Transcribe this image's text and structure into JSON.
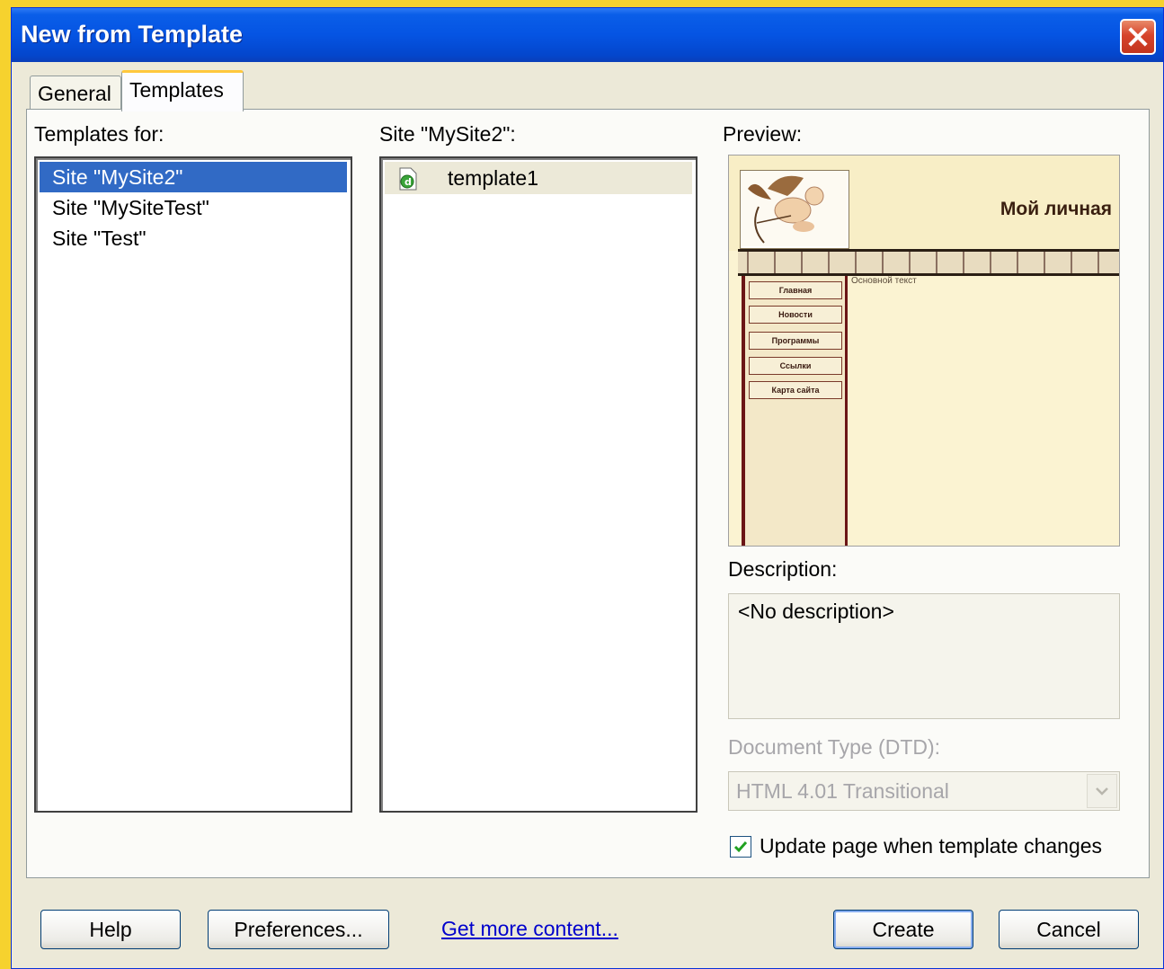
{
  "window": {
    "title": "New from Template"
  },
  "tabs": [
    {
      "label": "General"
    },
    {
      "label": "Templates"
    }
  ],
  "templates_for": {
    "label": "Templates for:",
    "items": [
      {
        "label": "Site \"MySite2\"",
        "selected": true
      },
      {
        "label": "Site \"MySiteTest\"",
        "selected": false
      },
      {
        "label": "Site \"Test\"",
        "selected": false
      }
    ]
  },
  "site_list": {
    "label": "Site \"MySite2\":",
    "items": [
      {
        "label": "template1",
        "icon": "dreamweaver-template-icon"
      }
    ]
  },
  "preview": {
    "label": "Preview:",
    "page_title": "Мой личная",
    "nav_items": [
      "Главная",
      "Новости",
      "Программы",
      "Ссылки",
      "Карта сайта"
    ],
    "body_text": "Основной текст"
  },
  "description": {
    "label": "Description:",
    "value": "<No description>"
  },
  "doctype": {
    "label": "Document Type (DTD):",
    "value": "HTML 4.01 Transitional",
    "enabled": false
  },
  "update_checkbox": {
    "label": "Update page when template changes",
    "checked": true
  },
  "buttons": {
    "help": "Help",
    "preferences": "Preferences...",
    "get_more": "Get more content...",
    "create": "Create",
    "cancel": "Cancel"
  },
  "colors": {
    "desktop": "#f6d22e",
    "titlebar": "#0554e3",
    "selection": "#316ac5",
    "link": "#0000cc"
  }
}
